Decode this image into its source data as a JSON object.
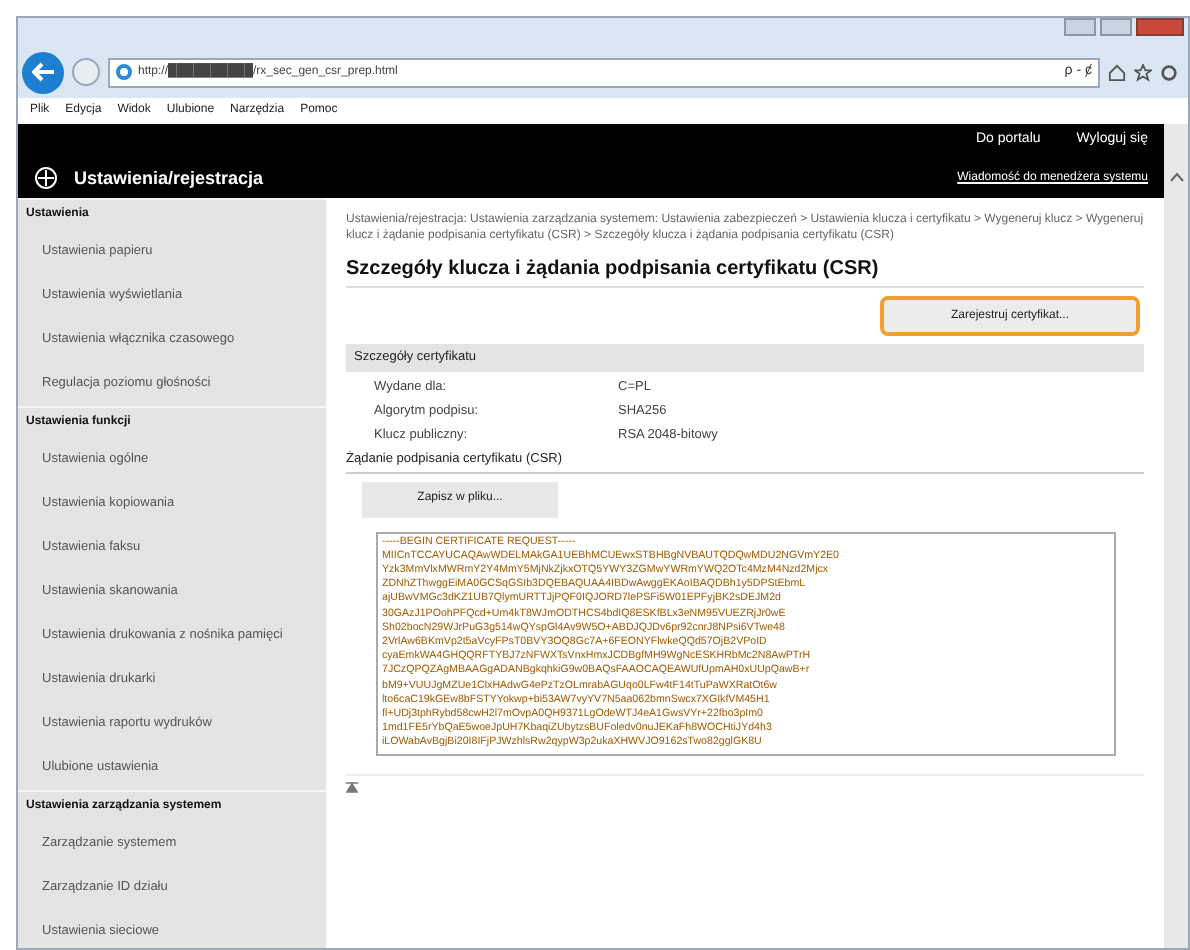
{
  "browser": {
    "url": "http://██████████/rx_sec_gen_csr_prep.html",
    "search_icon_text": "ρ - ȼ",
    "menu": [
      "Plik",
      "Edycja",
      "Widok",
      "Ulubione",
      "Narzędzia",
      "Pomoc"
    ]
  },
  "header": {
    "title": "Ustawienia/rejestracja",
    "links": [
      "Do portalu",
      "Wyloguj się"
    ],
    "message_link": "Wiadomość do menedżera systemu"
  },
  "sidebar": [
    {
      "heading": "Ustawienia",
      "items": [
        "Ustawienia papieru",
        "Ustawienia wyświetlania",
        "Ustawienia włącznika czasowego",
        "Regulacja poziomu głośności"
      ]
    },
    {
      "heading": "Ustawienia funkcji",
      "items": [
        "Ustawienia ogólne",
        "Ustawienia kopiowania",
        "Ustawienia faksu",
        "Ustawienia skanowania",
        "Ustawienia drukowania z nośnika pamięci",
        "Ustawienia drukarki",
        "Ustawienia raportu wydruków",
        "Ulubione ustawienia"
      ]
    },
    {
      "heading": "Ustawienia zarządzania systemem",
      "items": [
        "Zarządzanie systemem",
        "Zarządzanie ID działu",
        "Ustawienia sieciowe"
      ]
    }
  ],
  "breadcrumb": "Ustawienia/rejestracja: Ustawienia zarządzania systemem: Ustawienia zabezpieczeń > Ustawienia klucza i certyfikatu > Wygeneruj klucz > Wygeneruj klucz i żądanie podpisania certyfikatu (CSR) > Szczegóły klucza i żądania podpisania certyfikatu (CSR)",
  "page_title": "Szczegóły klucza i żądania podpisania certyfikatu (CSR)",
  "register_button": "Zarejestruj certyfikat...",
  "details": {
    "heading": "Szczegóły certyfikatu",
    "rows": [
      {
        "label": "Wydane dla:",
        "value": "C=PL"
      },
      {
        "label": "Algorytm podpisu:",
        "value": "SHA256"
      },
      {
        "label": "Klucz publiczny:",
        "value": "RSA 2048-bitowy"
      }
    ]
  },
  "csr": {
    "heading": "Żądanie podpisania certyfikatu (CSR)",
    "save_button": "Zapisz w pliku...",
    "lines": [
      "-----BEGIN CERTIFICATE REQUEST-----",
      "MIICnTCCAYUCAQAwWDELMAkGA1UEBhMCUEwxSTBHBgNVBAUTQDQwMDU2NGVmY2E0",
      "Yzk3MmVlxMWRmY2Y4MmY5MjNkZjkxOTQ5YWY3ZGMwYWRmYWQ2OTc4MzM4Nzd2Mjcx",
      "ZDNhZThwggEiMA0GCSqGSIb3DQEBAQUAA4IBDwAwggEKAoIBAQDBh1y5DPStEbmL",
      "ajUBwVMGc3dKZ1UB7QlymURTTJjPQF0IQJORD7lePSFi5W01EPFyjBK2sDEJM2d",
      "30GAzJ1POohPFQcd+Um4kT8WJmODTHCS4bdIQ8ESKfBLx3eNM95VUEZRjJr0wE",
      "Sh02bocN29WJrPuG3g514wQYspGl4Av9W5O+ABDJQJDv6pr92cnrJ8NPsi6VTwe48",
      "2VrlAw6BKmVp2t5aVcyFPsT0BVY3OQ8Gc7A+6FEONYFlwkeQQd57OjB2VPoID",
      "cyaEmkWA4GHQQRFTYBJ7zNFWXTsVnxHmxJCDBgfMH9WgNcESKHRbMc2N8AwPTrH",
      "7JCzQPQZAgMBAAGgADANBgkqhkiG9w0BAQsFAAOCAQEAWUfUpmAH0xUUpQawB+r",
      "bM9+VUUJgMZUe1ClxHAdwG4ePzTzOLmrabAGUqo0LFw4tF14tTuPaWXRatOt6w",
      "lto6caC19kGEw8bFSTYYokwp+bi53AW7vyYV7N5aa062bmnSwcx7XGIkfVM45H1",
      "fl+UDj3tphRybd58cwH2l7mOvpA0QH9371LgOdeWTJ4eA1GwsVYr+22fbo3pIm0",
      "1md1FE5rYbQaE5woeJpUH7KbaqiZUbytzsBUFoledv0nuJEKaFh8WOCHtiJYd4h3",
      "iLOWabAvBgjBi20I8IFjPJWzhlsRw2qypW3p2ukaXHWVJO9162sTwo82gglGK8U"
    ]
  }
}
